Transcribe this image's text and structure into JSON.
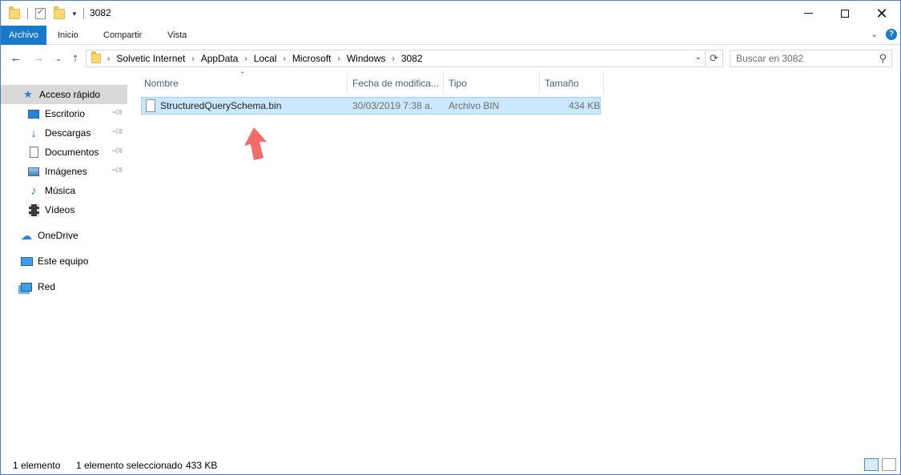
{
  "window": {
    "title": "3082",
    "minimize_icon": "minimize-icon",
    "maximize_icon": "maximize-icon",
    "close_icon": "close-icon"
  },
  "ribbon": {
    "tabs": [
      {
        "label": "Archivo",
        "active": true
      },
      {
        "label": "Inicio"
      },
      {
        "label": "Compartir"
      },
      {
        "label": "Vista"
      }
    ],
    "help_label": "?",
    "accent_color": "#1979ca"
  },
  "address": {
    "crumbs": [
      "Solvetic Internet",
      "AppData",
      "Local",
      "Microsoft",
      "Windows",
      "3082"
    ]
  },
  "search": {
    "placeholder": "Buscar en 3082"
  },
  "sidebar": {
    "items": [
      {
        "label": "Acceso rápido",
        "icon": "star-icon",
        "selected": true
      },
      {
        "label": "Escritorio",
        "icon": "desktop-icon",
        "pinned": true
      },
      {
        "label": "Descargas",
        "icon": "download-icon",
        "pinned": true
      },
      {
        "label": "Documentos",
        "icon": "documents-icon",
        "pinned": true
      },
      {
        "label": "Imágenes",
        "icon": "pictures-icon",
        "pinned": true
      },
      {
        "label": "Música",
        "icon": "music-icon"
      },
      {
        "label": "Vídeos",
        "icon": "videos-icon"
      },
      {
        "label": "OneDrive",
        "icon": "onedrive-icon"
      },
      {
        "label": "Este equipo",
        "icon": "computer-icon"
      },
      {
        "label": "Red",
        "icon": "network-icon"
      }
    ]
  },
  "filelist": {
    "columns": [
      "Nombre",
      "Fecha de modifica...",
      "Tipo",
      "Tamaño"
    ],
    "rows": [
      {
        "name": "StructuredQuerySchema.bin",
        "date": "30/03/2019 7:38 a.",
        "type": "Archivo BIN",
        "size": "434 KB",
        "selected": true
      }
    ]
  },
  "status": {
    "count": "1 elemento",
    "selection": "1 elemento seleccionado",
    "selection_size": "433 KB"
  },
  "annotation": {
    "arrow_color": "#f26b6b"
  }
}
